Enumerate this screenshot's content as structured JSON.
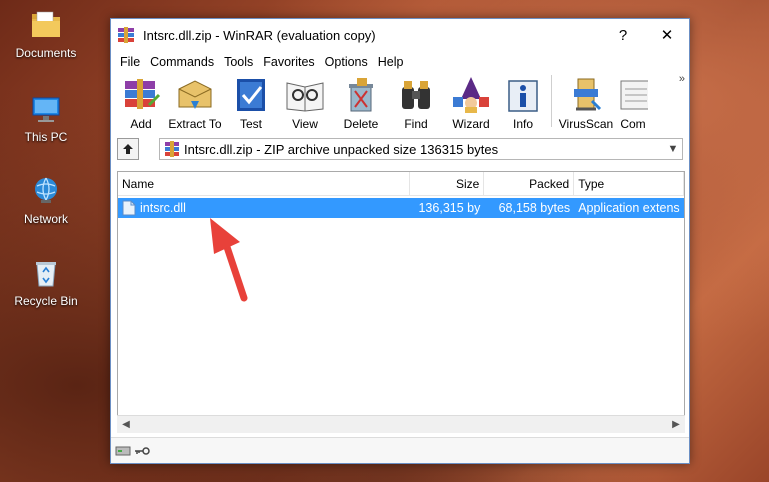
{
  "desktop": {
    "icons": [
      {
        "label": "Documents"
      },
      {
        "label": "This PC"
      },
      {
        "label": "Network"
      },
      {
        "label": "Recycle Bin"
      }
    ]
  },
  "window": {
    "title": "Intsrc.dll.zip - WinRAR (evaluation copy)",
    "help_glyph": "?",
    "close_glyph": "✕"
  },
  "menu": [
    "File",
    "Commands",
    "Tools",
    "Favorites",
    "Options",
    "Help"
  ],
  "toolbar": {
    "buttons": [
      {
        "label": "Add",
        "icon": "add-icon"
      },
      {
        "label": "Extract To",
        "icon": "extract-icon"
      },
      {
        "label": "Test",
        "icon": "test-icon"
      },
      {
        "label": "View",
        "icon": "view-icon"
      },
      {
        "label": "Delete",
        "icon": "delete-icon"
      },
      {
        "label": "Find",
        "icon": "find-icon"
      },
      {
        "label": "Wizard",
        "icon": "wizard-icon"
      },
      {
        "label": "Info",
        "icon": "info-icon"
      },
      {
        "label": "VirusScan",
        "icon": "virusscan-icon"
      },
      {
        "label": "Com",
        "icon": "comment-icon"
      }
    ],
    "more_glyph": "»"
  },
  "address": {
    "text": "Intsrc.dll.zip - ZIP archive unpacked size 136315 bytes"
  },
  "filelist": {
    "columns": {
      "name": "Name",
      "size": "Size",
      "packed": "Packed",
      "type": "Type"
    },
    "rows": [
      {
        "name": "intsrc.dll",
        "size": "136,315 by",
        "packed": "68,158 bytes",
        "type": "Application extens"
      }
    ]
  },
  "colors": {
    "selection": "#3399ff",
    "annotation_arrow": "#e8413a"
  }
}
